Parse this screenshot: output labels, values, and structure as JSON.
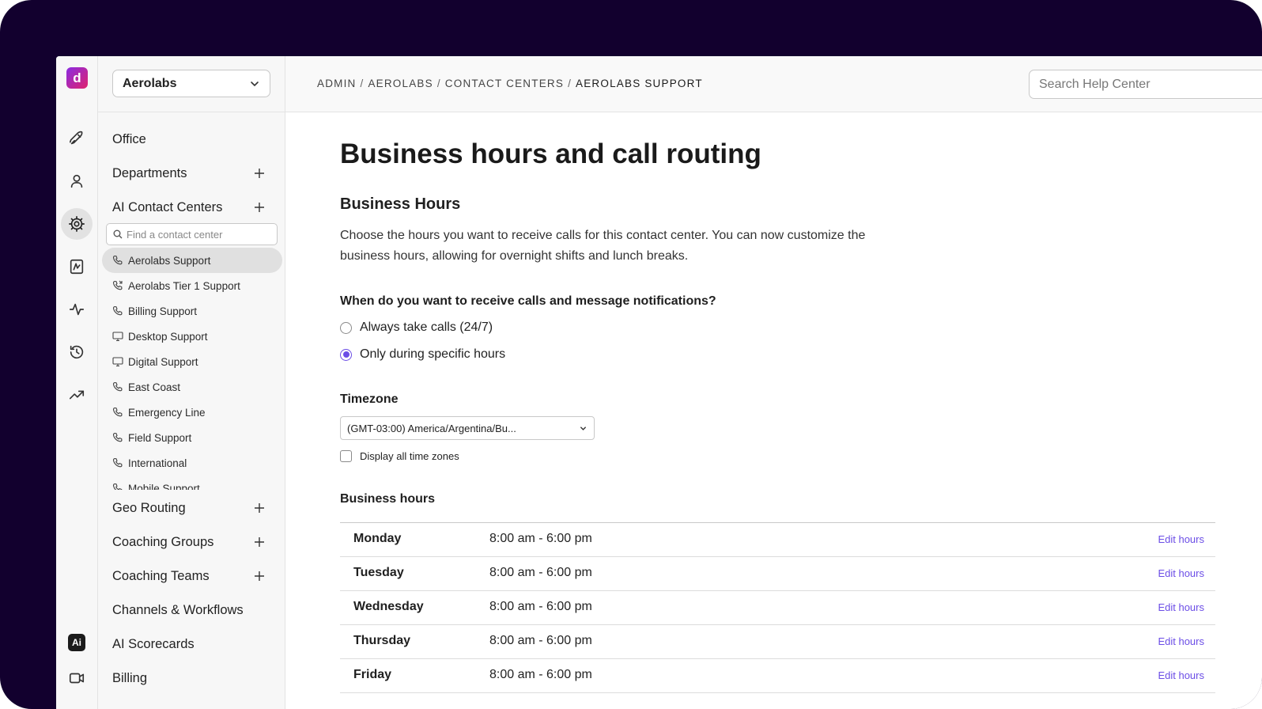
{
  "rail": {
    "logo_letter": "d",
    "icons": [
      "rocket-icon",
      "person-icon",
      "gear-icon",
      "ai-assist-icon",
      "activity-icon",
      "history-icon",
      "trending-up-icon"
    ],
    "bottom_badge": "Ai",
    "active_icon": "gear-icon",
    "accent_color": "#6b4de6"
  },
  "sidebar": {
    "org": "Aerolabs",
    "items_top": [
      {
        "label": "Office",
        "has_add": false
      },
      {
        "label": "Departments",
        "has_add": true
      },
      {
        "label": "AI Contact Centers",
        "has_add": true
      }
    ],
    "search_placeholder": "Find a contact center",
    "contact_centers": [
      {
        "label": "Aerolabs Support",
        "icon": "phone-icon",
        "active": true
      },
      {
        "label": "Aerolabs Tier 1 Support",
        "icon": "phone-forward-icon",
        "active": false
      },
      {
        "label": "Billing Support",
        "icon": "phone-icon",
        "active": false
      },
      {
        "label": "Desktop Support",
        "icon": "monitor-icon",
        "active": false
      },
      {
        "label": "Digital Support",
        "icon": "monitor-icon",
        "active": false
      },
      {
        "label": "East Coast",
        "icon": "phone-icon",
        "active": false
      },
      {
        "label": "Emergency Line",
        "icon": "phone-icon",
        "active": false
      },
      {
        "label": "Field Support",
        "icon": "phone-icon",
        "active": false
      },
      {
        "label": "International",
        "icon": "phone-icon",
        "active": false
      },
      {
        "label": "Mobile Support",
        "icon": "phone-icon",
        "active": false
      }
    ],
    "items_bottom": [
      {
        "label": "Geo Routing",
        "has_add": true
      },
      {
        "label": "Coaching Groups",
        "has_add": true
      },
      {
        "label": "Coaching Teams",
        "has_add": true
      },
      {
        "label": "Channels & Workflows",
        "has_add": false
      },
      {
        "label": "AI Scorecards",
        "has_add": false
      },
      {
        "label": "Billing",
        "has_add": false
      }
    ]
  },
  "header": {
    "breadcrumb": [
      "ADMIN",
      "AEROLABS",
      "CONTACT CENTERS",
      "AEROLABS SUPPORT"
    ],
    "search_placeholder": "Search Help Center"
  },
  "main": {
    "title": "Business hours and call routing",
    "section_title": "Business Hours",
    "description": "Choose the hours you want to receive calls for this contact center. You can now customize the business hours, allowing for overnight shifts and lunch breaks.",
    "question": "When do you want to receive calls and message notifications?",
    "options": [
      {
        "label": "Always take calls (24/7)",
        "checked": false
      },
      {
        "label": "Only during specific hours",
        "checked": true
      }
    ],
    "timezone_label": "Timezone",
    "timezone_value": "(GMT-03:00) America/Argentina/Bu...",
    "display_all_tz_label": "Display all time zones",
    "display_all_tz_checked": false,
    "hours_label": "Business hours",
    "edit_label": "Edit hours",
    "hours": [
      {
        "day": "Monday",
        "time": "8:00 am - 6:00 pm"
      },
      {
        "day": "Tuesday",
        "time": "8:00 am - 6:00 pm"
      },
      {
        "day": "Wednesday",
        "time": "8:00 am - 6:00 pm"
      },
      {
        "day": "Thursday",
        "time": "8:00 am - 6:00 pm"
      },
      {
        "day": "Friday",
        "time": "8:00 am - 6:00 pm"
      }
    ]
  }
}
